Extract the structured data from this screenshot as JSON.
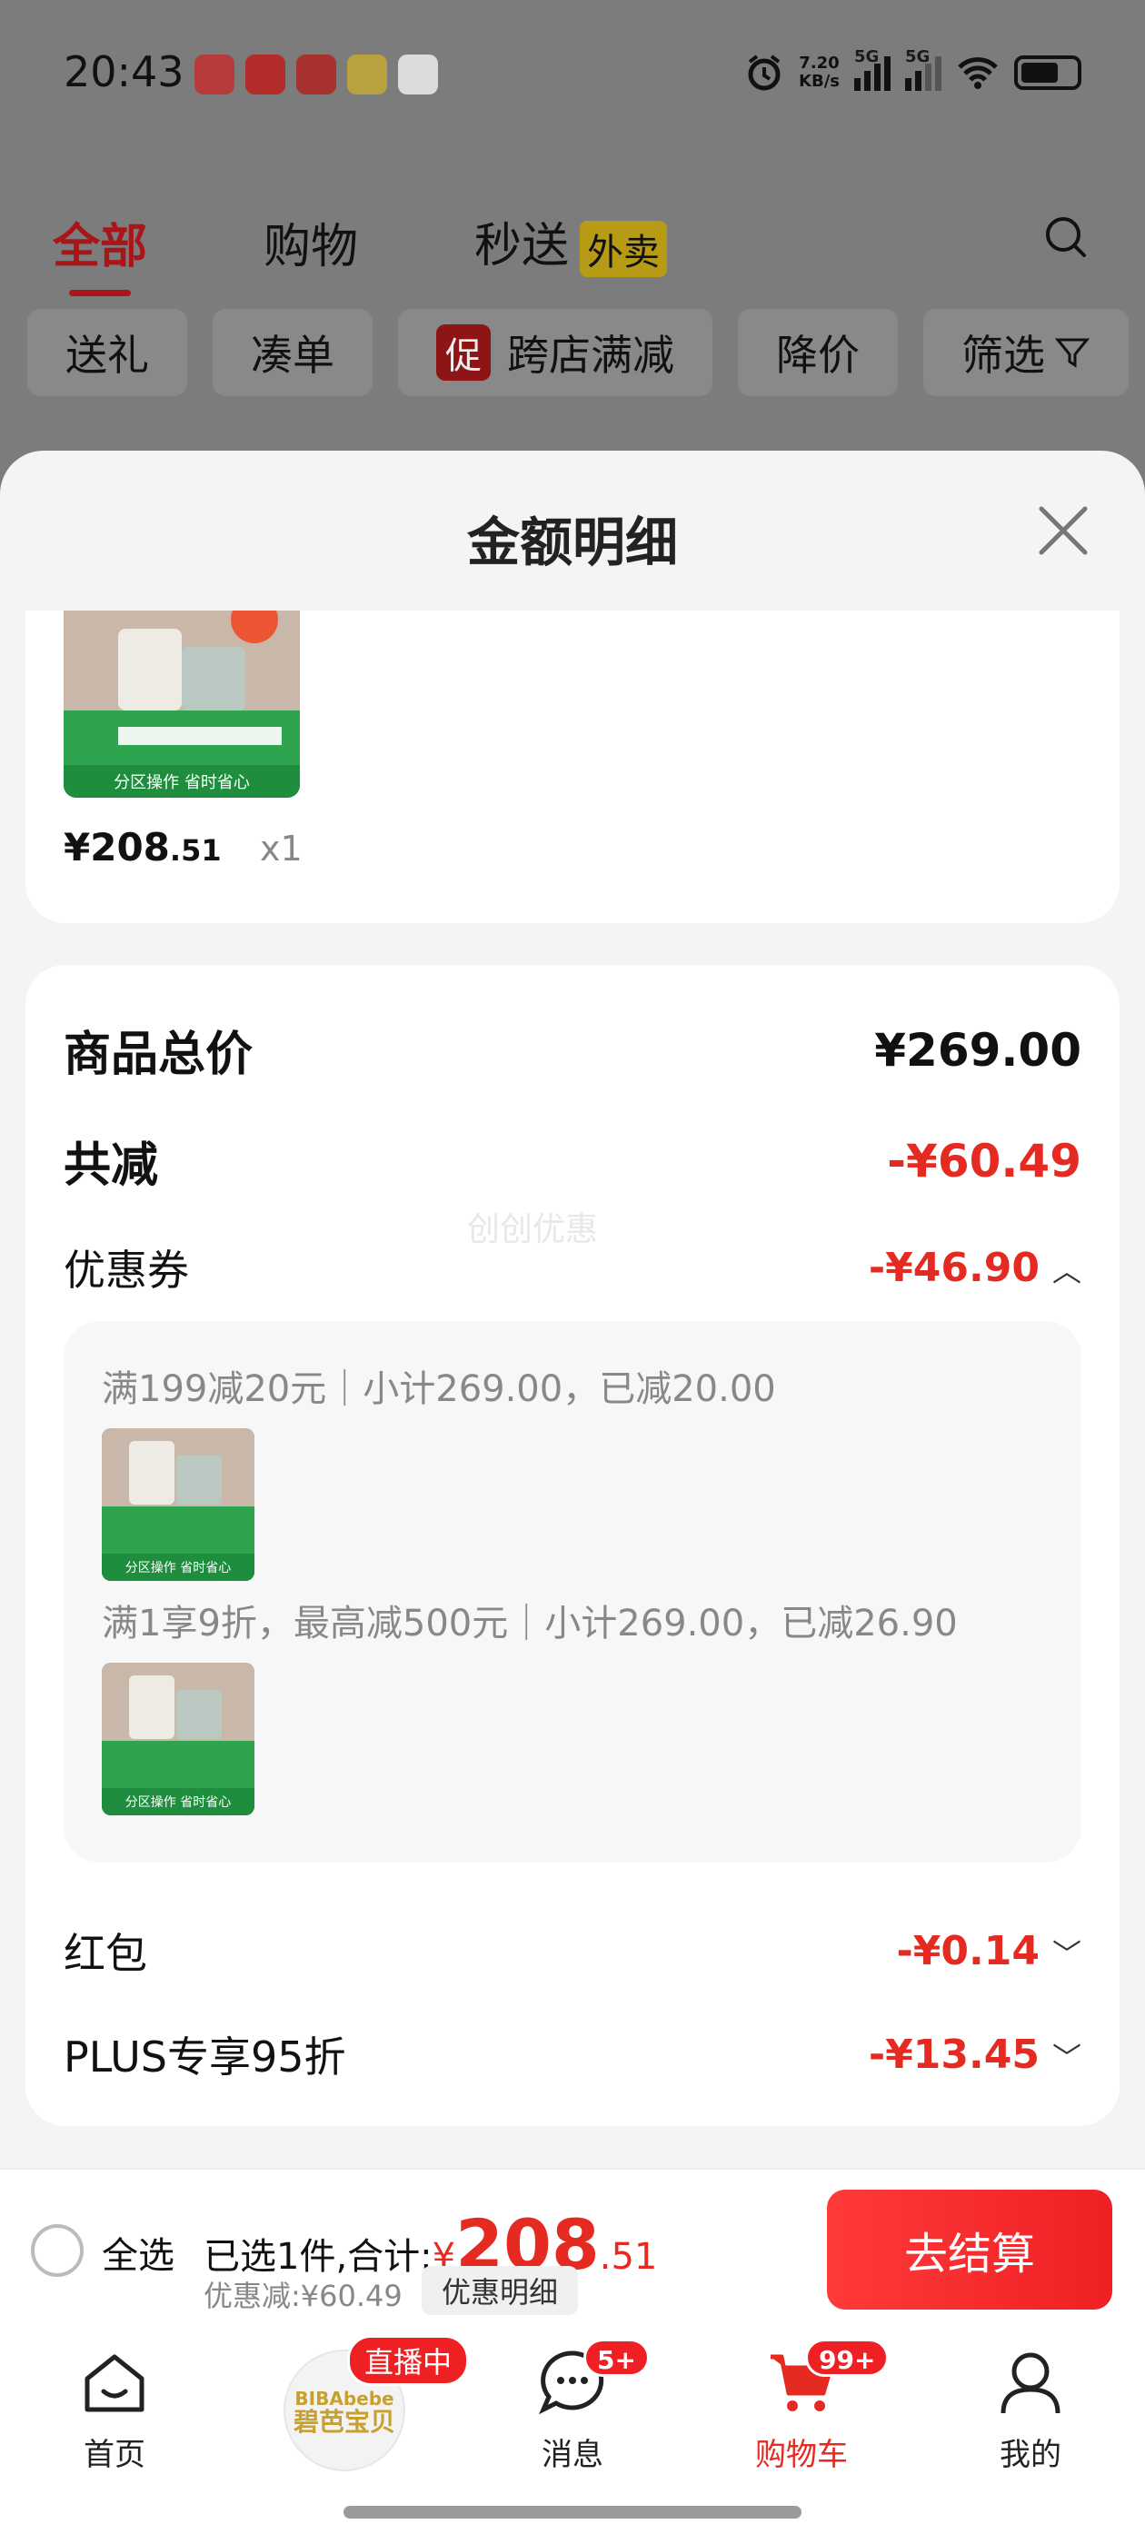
{
  "status_bar": {
    "time": "20:43",
    "net_speed_value": "7.20",
    "net_speed_unit": "KB/s",
    "sim1": "5G",
    "sim2": "5G"
  },
  "top_tabs": [
    {
      "label": "全部"
    },
    {
      "label": "购物"
    },
    {
      "label": "秒送",
      "tag": "外卖"
    }
  ],
  "filter_chips": [
    {
      "label": "送礼"
    },
    {
      "label": "凑单"
    },
    {
      "label": "跨店满减",
      "tag": "促"
    },
    {
      "label": "降价"
    },
    {
      "label": "筛选"
    }
  ],
  "sheet": {
    "title": "金额明细",
    "product": {
      "price_int": "¥208",
      "price_dec": ".51",
      "qty": "x1"
    },
    "total_label": "商品总价",
    "total_value": "¥269.00",
    "saved_label": "共减",
    "saved_value": "-¥60.49",
    "watermark": "创创优惠",
    "coupon_label": "优惠券",
    "coupon_value": "-¥46.90",
    "coupon_details": [
      {
        "text": "满199减20元｜小计269.00，已减20.00"
      },
      {
        "text": "满1享9折，最高减500元｜小计269.00，已减26.90"
      }
    ],
    "redpacket_label": "红包",
    "redpacket_value": "-¥0.14",
    "plus_label": "PLUS专享95折",
    "plus_value": "-¥13.45"
  },
  "checkout": {
    "select_all": "全选",
    "summary_prefix": "已选1件,合计:",
    "yen": "¥",
    "amount_int": "208",
    "amount_dec": ".51",
    "discount_text": "优惠减:¥60.49",
    "detail_button": "优惠明细",
    "pay_button": "去结算"
  },
  "tabbar": {
    "home": "首页",
    "live_tag": "直播中",
    "live_brand_line1": "BIBAbebe",
    "live_brand_line2": "碧芭宝贝",
    "messages": "消息",
    "messages_badge": "5+",
    "cart": "购物车",
    "cart_badge": "99+",
    "me": "我的"
  },
  "colors": {
    "accent_red": "#e52a22",
    "tab_red": "#a8161a",
    "sheet_bg": "#f4f4f4"
  }
}
